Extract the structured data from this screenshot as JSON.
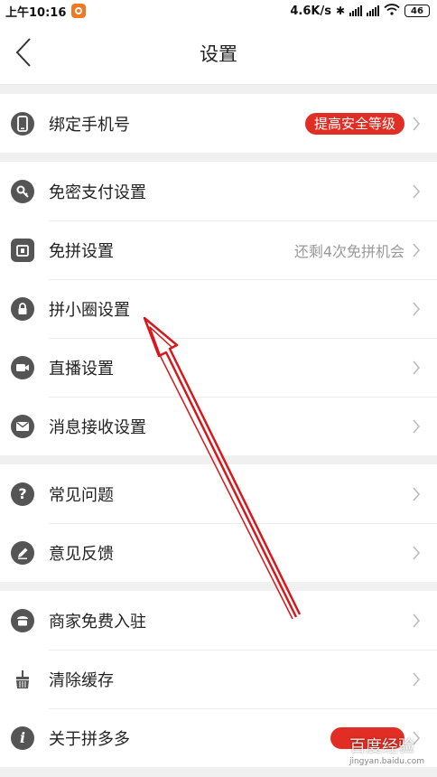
{
  "status_bar": {
    "time": "上午10:16",
    "network_speed": "4.6K/s",
    "battery": "46"
  },
  "nav": {
    "title": "设置"
  },
  "groups": [
    {
      "items": [
        {
          "label": "绑定手机号",
          "icon": "phone-icon",
          "badge": "提高安全等级"
        }
      ]
    },
    {
      "items": [
        {
          "label": "免密支付设置",
          "icon": "key-icon"
        },
        {
          "label": "免拼设置",
          "icon": "coupon-icon",
          "hint": "还剩4次免拼机会"
        },
        {
          "label": "拼小圈设置",
          "icon": "lock-icon"
        },
        {
          "label": "直播设置",
          "icon": "video-camera-icon"
        },
        {
          "label": "消息接收设置",
          "icon": "mail-icon"
        }
      ]
    },
    {
      "items": [
        {
          "label": "常见问题",
          "icon": "question-icon"
        },
        {
          "label": "意见反馈",
          "icon": "pencil-icon"
        }
      ]
    },
    {
      "items": [
        {
          "label": "商家免费入驻",
          "icon": "store-icon"
        },
        {
          "label": "清除缓存",
          "icon": "broom-icon"
        },
        {
          "label": "关于拼多多",
          "icon": "info-icon"
        }
      ]
    }
  ],
  "watermark": {
    "text": "百度经验",
    "sub": "jingyan.baidu.com"
  },
  "colors": {
    "accent_red": "#e02e24",
    "icon_gray": "#555555",
    "annotation_arrow": "#d8171b"
  }
}
